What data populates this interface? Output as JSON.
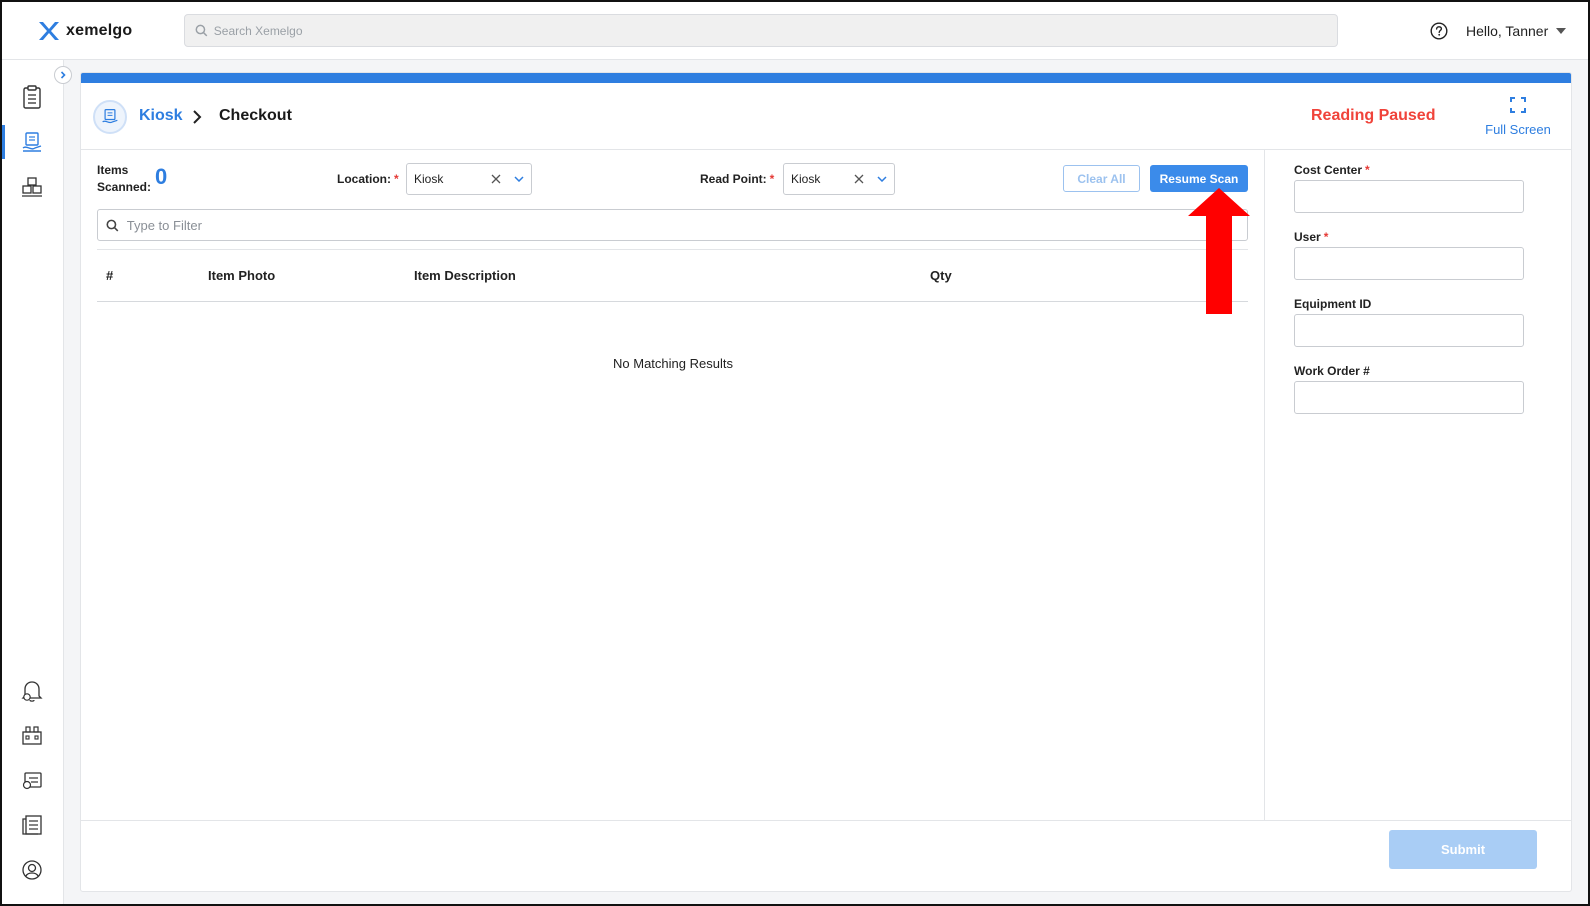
{
  "app": {
    "brand": "xemelgo",
    "search_placeholder": "Search Xemelgo",
    "greeting": "Hello, Tanner",
    "accent_color": "#2e7ee0"
  },
  "sidebar": {
    "items": [
      {
        "icon": "clipboard-icon",
        "active": false
      },
      {
        "icon": "kiosk-icon",
        "active": true
      },
      {
        "icon": "inventory-icon",
        "active": false
      },
      {
        "icon": "alerts-settings-icon",
        "active": false
      },
      {
        "icon": "building-icon",
        "active": false
      },
      {
        "icon": "reports-settings-icon",
        "active": false
      },
      {
        "icon": "list-icon",
        "active": false
      },
      {
        "icon": "user-profile-icon",
        "active": false
      }
    ]
  },
  "header": {
    "breadcrumb_root": "Kiosk",
    "breadcrumb_current": "Checkout",
    "status": "Reading Paused",
    "status_color": "#f0433a",
    "fullscreen_label": "Full Screen"
  },
  "scan": {
    "items_scanned_label_1": "Items",
    "items_scanned_label_2": "Scanned:",
    "items_scanned_count": "0",
    "location_label": "Location:",
    "location_value": "Kiosk",
    "read_point_label": "Read Point:",
    "read_point_value": "Kiosk",
    "required_mark": "*",
    "clear_all_label": "Clear All",
    "resume_scan_label": "Resume Scan",
    "filter_placeholder": "Type to Filter"
  },
  "table": {
    "columns": [
      "#",
      "Item Photo",
      "Item Description",
      "Qty"
    ],
    "rows": [],
    "empty_message": "No Matching Results"
  },
  "form": {
    "fields": [
      {
        "label": "Cost Center",
        "required": true,
        "value": ""
      },
      {
        "label": "User",
        "required": true,
        "value": ""
      },
      {
        "label": "Equipment ID",
        "required": false,
        "value": ""
      },
      {
        "label": "Work Order #",
        "required": false,
        "value": ""
      }
    ],
    "submit_label": "Submit"
  },
  "annotation": {
    "arrow_icon": "red-up-arrow-icon",
    "color": "#ff0000"
  }
}
